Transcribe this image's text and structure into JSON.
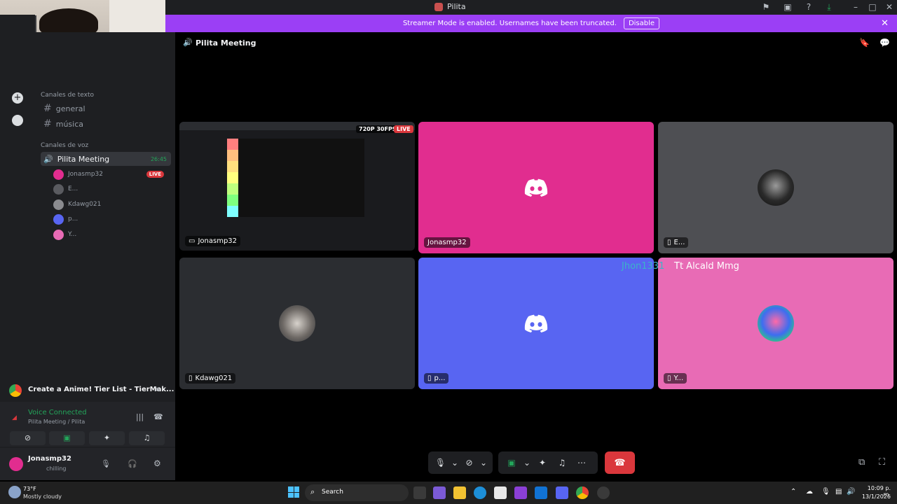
{
  "window": {
    "title": "Pilita"
  },
  "banner": {
    "text": "Streamer Mode is enabled. Usernames have been truncated.",
    "disable_label": "Disable"
  },
  "channels": {
    "text_category": "Canales de texto",
    "text_channels": [
      "general",
      "música"
    ],
    "voice_category": "Canales de voz",
    "voice_channel": "Pilita Meeting",
    "voice_timer": "26:45",
    "members": [
      {
        "name": "Jonasmp32",
        "live": "LIVE"
      },
      {
        "name": "E..."
      },
      {
        "name": "Kdawg021"
      },
      {
        "name": "p..."
      },
      {
        "name": "Y..."
      }
    ]
  },
  "header": {
    "channel_name": "Pilita Meeting"
  },
  "stream": {
    "badge_res": "720P 30FPS",
    "badge_live": "LIVE"
  },
  "tiles": [
    {
      "name": "Jonasmp32",
      "color": "#e12d8f"
    },
    {
      "name": "Jonasmp32",
      "color": "#e12d8f"
    },
    {
      "name": "E...",
      "color": "#4e4f53"
    },
    {
      "name": "Kdawg021",
      "color": "#2b2d31"
    },
    {
      "name": "p...",
      "color": "#5865f2"
    },
    {
      "name": "Y...",
      "color": "#e86bb5"
    }
  ],
  "floating_names": {
    "first": "Jhon1331",
    "second": "Tt Alcald Mmg"
  },
  "activity": {
    "title": "Create a Anime! Tier List - TierMak..."
  },
  "voice_status": {
    "title": "Voice Connected",
    "subtitle": "Pilita Meeting / Pilita"
  },
  "user": {
    "name": "Jonasmp32",
    "status": "chilling"
  },
  "taskbar": {
    "weather_temp": "73°F",
    "weather_text": "Mostly cloudy",
    "search_label": "Search",
    "time": "10:09 p. m.",
    "date": "13/1/2026"
  }
}
